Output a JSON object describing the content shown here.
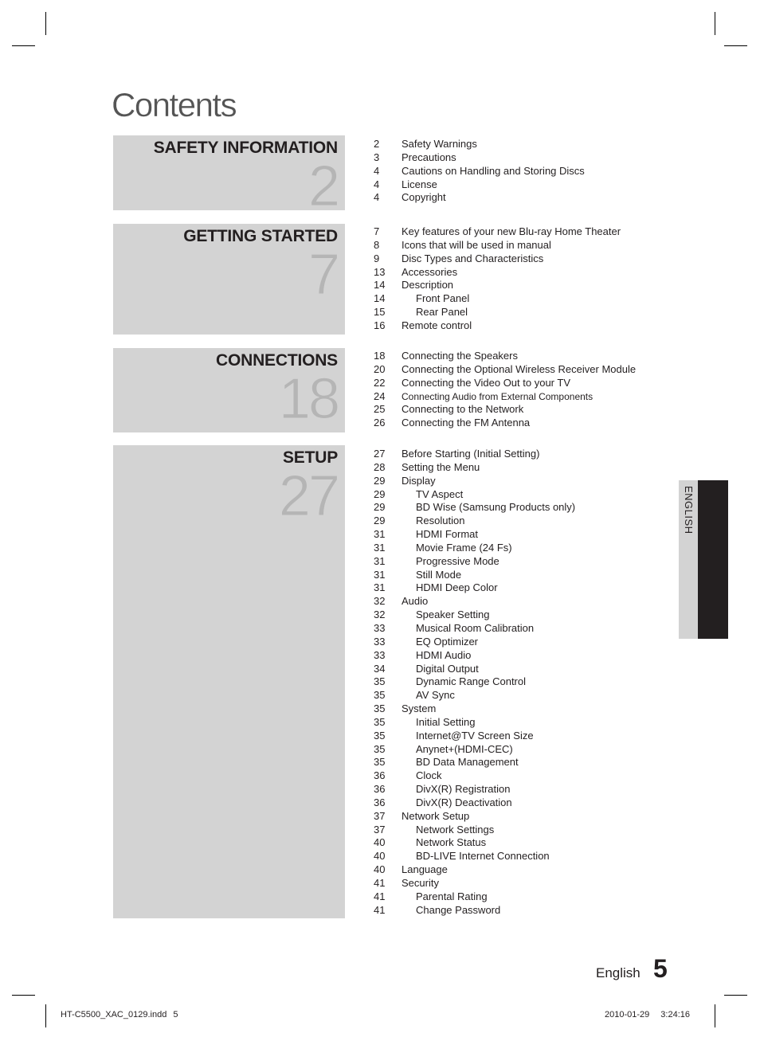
{
  "page": {
    "title": "Contents",
    "language_tab": "ENGLISH",
    "footer_language": "English",
    "footer_page_number": "5",
    "slug_file": "HT-C5500_XAC_0129.indd",
    "slug_page": "5",
    "slug_date": "2010-01-29",
    "slug_time": "3:24:16"
  },
  "sections": [
    {
      "title": "SAFETY INFORMATION",
      "page": "2",
      "entries": [
        {
          "page": "2",
          "text": "Safety Warnings",
          "level": 1
        },
        {
          "page": "3",
          "text": "Precautions",
          "level": 1
        },
        {
          "page": "4",
          "text": "Cautions on Handling and Storing Discs",
          "level": 1
        },
        {
          "page": "4",
          "text": "License",
          "level": 1
        },
        {
          "page": "4",
          "text": "Copyright",
          "level": 1
        }
      ]
    },
    {
      "title": "GETTING STARTED",
      "page": "7",
      "entries": [
        {
          "page": "7",
          "text": "Key features of your new Blu-ray Home Theater",
          "level": 1
        },
        {
          "page": "8",
          "text": "Icons that will be used in manual",
          "level": 1
        },
        {
          "page": "9",
          "text": "Disc Types and Characteristics",
          "level": 1
        },
        {
          "page": "13",
          "text": "Accessories",
          "level": 1
        },
        {
          "page": "14",
          "text": "Description",
          "level": 1
        },
        {
          "page": "14",
          "text": "Front Panel",
          "level": 2
        },
        {
          "page": "15",
          "text": "Rear Panel",
          "level": 2
        },
        {
          "page": "16",
          "text": "Remote control",
          "level": 1
        }
      ]
    },
    {
      "title": "CONNECTIONS",
      "page": "18",
      "entries": [
        {
          "page": "18",
          "text": "Connecting the Speakers",
          "level": 1
        },
        {
          "page": "20",
          "text": "Connecting the Optional Wireless Receiver Module",
          "level": 1
        },
        {
          "page": "22",
          "text": "Connecting the Video Out to your TV",
          "level": 1
        },
        {
          "page": "24",
          "text": "Connecting Audio from External Components",
          "level": 1
        },
        {
          "page": "25",
          "text": "Connecting to the Network",
          "level": 1
        },
        {
          "page": "26",
          "text": "Connecting the FM Antenna",
          "level": 1
        }
      ]
    },
    {
      "title": "SETUP",
      "page": "27",
      "entries": [
        {
          "page": "27",
          "text": "Before Starting (Initial Setting)",
          "level": 1
        },
        {
          "page": "28",
          "text": "Setting the Menu",
          "level": 1
        },
        {
          "page": "29",
          "text": "Display",
          "level": 1
        },
        {
          "page": "29",
          "text": "TV Aspect",
          "level": 2
        },
        {
          "page": "29",
          "text": "BD Wise (Samsung Products only)",
          "level": 2
        },
        {
          "page": "29",
          "text": "Resolution",
          "level": 2
        },
        {
          "page": "31",
          "text": "HDMI Format",
          "level": 2
        },
        {
          "page": "31",
          "text": "Movie Frame (24 Fs)",
          "level": 2
        },
        {
          "page": "31",
          "text": "Progressive Mode",
          "level": 2
        },
        {
          "page": "31",
          "text": "Still Mode",
          "level": 2
        },
        {
          "page": "31",
          "text": "HDMI Deep Color",
          "level": 2
        },
        {
          "page": "32",
          "text": "Audio",
          "level": 1
        },
        {
          "page": "32",
          "text": "Speaker Setting",
          "level": 2
        },
        {
          "page": "33",
          "text": "Musical Room Calibration",
          "level": 2
        },
        {
          "page": "33",
          "text": "EQ Optimizer",
          "level": 2
        },
        {
          "page": "33",
          "text": "HDMI Audio",
          "level": 2
        },
        {
          "page": "34",
          "text": "Digital Output",
          "level": 2
        },
        {
          "page": "35",
          "text": "Dynamic Range Control",
          "level": 2
        },
        {
          "page": "35",
          "text": "AV Sync",
          "level": 2
        },
        {
          "page": "35",
          "text": "System",
          "level": 1
        },
        {
          "page": "35",
          "text": "Initial Setting",
          "level": 2
        },
        {
          "page": "35",
          "text": "Internet@TV Screen Size",
          "level": 2
        },
        {
          "page": "35",
          "text": "Anynet+(HDMI-CEC)",
          "level": 2
        },
        {
          "page": "35",
          "text": "BD Data Management",
          "level": 2
        },
        {
          "page": "36",
          "text": "Clock",
          "level": 2
        },
        {
          "page": "36",
          "text": "DivX(R) Registration",
          "level": 2
        },
        {
          "page": "36",
          "text": "DivX(R) Deactivation",
          "level": 2
        },
        {
          "page": "37",
          "text": "Network Setup",
          "level": 1
        },
        {
          "page": "37",
          "text": "Network Settings",
          "level": 2
        },
        {
          "page": "40",
          "text": "Network Status",
          "level": 2
        },
        {
          "page": "40",
          "text": "BD-LIVE Internet Connection",
          "level": 2
        },
        {
          "page": "40",
          "text": "Language",
          "level": 1
        },
        {
          "page": "41",
          "text": "Security",
          "level": 1
        },
        {
          "page": "41",
          "text": "Parental Rating",
          "level": 2
        },
        {
          "page": "41",
          "text": "Change Password",
          "level": 2
        }
      ]
    }
  ]
}
